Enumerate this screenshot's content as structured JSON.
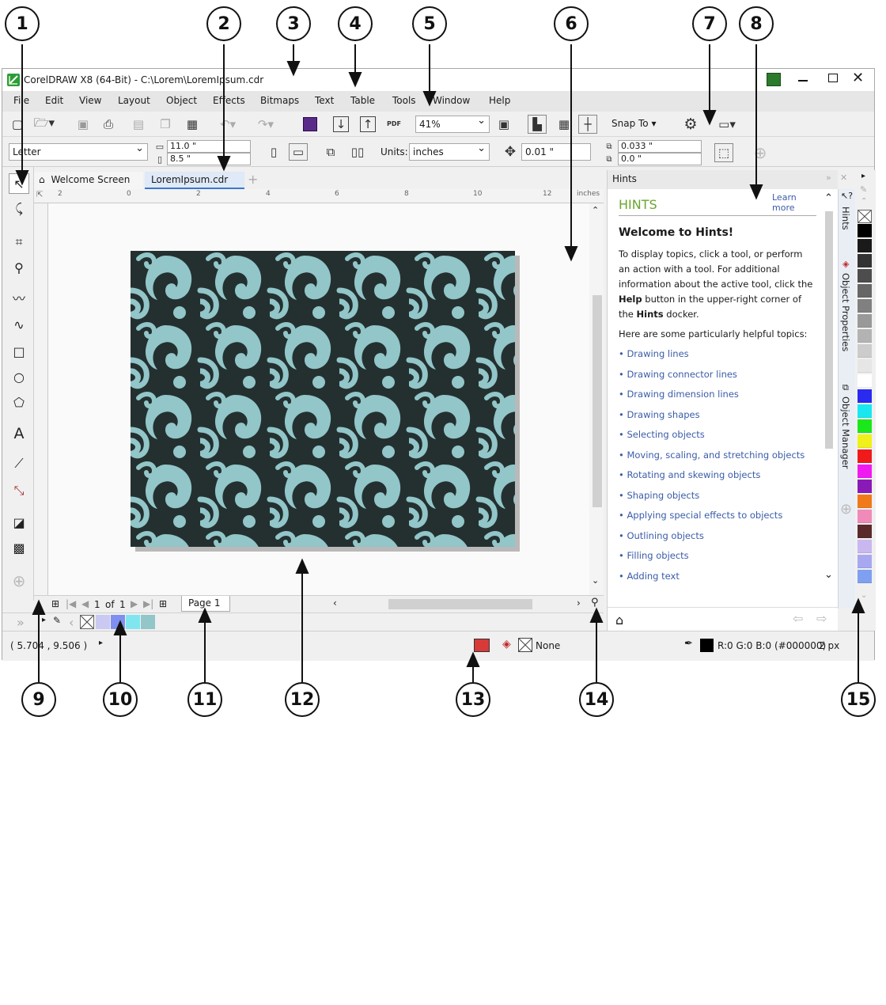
{
  "callouts": [
    "1",
    "2",
    "3",
    "4",
    "5",
    "6",
    "7",
    "8",
    "9",
    "10",
    "11",
    "12",
    "13",
    "14",
    "15"
  ],
  "window": {
    "title": "CorelDRAW X8 (64-Bit) - C:\\Lorem\\LoremIpsum.cdr",
    "app_icon": "coreldraw-logo-icon",
    "controls": [
      "user-icon",
      "minimize-icon",
      "maximize-icon",
      "close-icon"
    ]
  },
  "menu": [
    "File",
    "Edit",
    "View",
    "Layout",
    "Object",
    "Effects",
    "Bitmaps",
    "Text",
    "Table",
    "Tools",
    "Window",
    "Help"
  ],
  "toolbar": {
    "zoom": "41%",
    "snap_label": "Snap To",
    "pdf_label": "PDF"
  },
  "property_bar": {
    "page_size": "Letter",
    "width": "11.0 \"",
    "height": "8.5 \"",
    "units_label": "Units:",
    "units": "inches",
    "nudge": "0.01 \"",
    "dup_x": "0.033 \"",
    "dup_y": "0.0 \""
  },
  "tabs": [
    "Welcome Screen",
    "LoremIpsum.cdr"
  ],
  "ruler": {
    "h_ticks": [
      "2",
      "0",
      "2",
      "4",
      "6",
      "8",
      "10",
      "12"
    ],
    "unit": "inches"
  },
  "pagebar": {
    "page_of": "1",
    "of_label": "of",
    "page_total": "1",
    "page_tab": "Page 1"
  },
  "docker": {
    "title": "Hints",
    "heading": "HINTS",
    "learn_more": "Learn more",
    "welcome": "Welcome to Hints!",
    "intro_1": "To display topics, click a tool, or perform an action with a tool. For additional information about the active tool, click the ",
    "intro_help": "Help",
    "intro_2": " button in the upper-right corner of the ",
    "intro_hints": "Hints",
    "intro_3": " docker.",
    "topics_intro": "Here are some particularly helpful topics:",
    "topics": [
      "• Drawing lines",
      "• Drawing connector lines",
      "• Drawing dimension lines",
      "• Drawing shapes",
      "• Selecting objects",
      "• Moving, scaling, and stretching objects",
      "• Rotating and skewing objects",
      "• Shaping objects",
      "• Applying special effects to objects",
      "• Outlining objects",
      "• Filling objects",
      "• Adding text"
    ]
  },
  "docker_tabs": [
    "Hints",
    "Object Properties",
    "Object Manager"
  ],
  "status": {
    "coords": "( 5.704 , 9.506 )",
    "fill": "None",
    "outline": "R:0 G:0 B:0 (#000000)",
    "outline_width": "2 px"
  },
  "colors": {
    "accent_green": "#6aa52e",
    "link_blue": "#3a5ca8",
    "pattern_dark": "#243030",
    "pattern_light": "#92c6c9",
    "document_palette": [
      "#ffffff",
      "#c9c9f2",
      "#7f8ff0",
      "#7fe6f0",
      "#92c6c9"
    ],
    "palette": [
      "#000000",
      "#1a1a1a",
      "#333333",
      "#4d4d4d",
      "#666666",
      "#808080",
      "#999999",
      "#b3b3b3",
      "#cccccc",
      "#e6e6e6",
      "#ffffff",
      "#2a2af0",
      "#1ae8f0",
      "#1ae81a",
      "#f0f01a",
      "#f01a1a",
      "#f01af0",
      "#8a1ab8",
      "#f07a1a",
      "#f08ab8",
      "#5a2a2a",
      "#c9b8f0",
      "#a8a8f0",
      "#7f9ff0"
    ]
  }
}
